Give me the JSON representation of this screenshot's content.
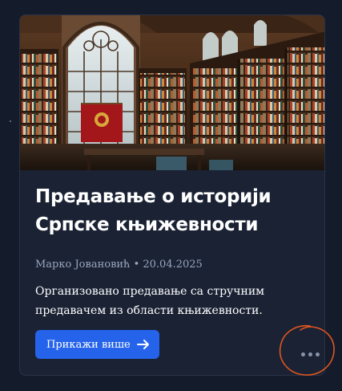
{
  "card": {
    "image_alt": "library-interior",
    "title": "Предавање о историји Српске књижевности",
    "author": "Марко Јовановић",
    "separator": "•",
    "date": "20.04.2025",
    "description": "Организовано предавање са стручним предавачем из области књижевности.",
    "more_label": "Прикажи више",
    "more_icon": "arrow-right-icon",
    "options_icon": "more-horizontal-icon"
  },
  "colors": {
    "background": "#141b2b",
    "card": "#1a2234",
    "accent": "#2563eb",
    "annotation": "#e0561f",
    "muted_text": "#9aa6bc"
  }
}
